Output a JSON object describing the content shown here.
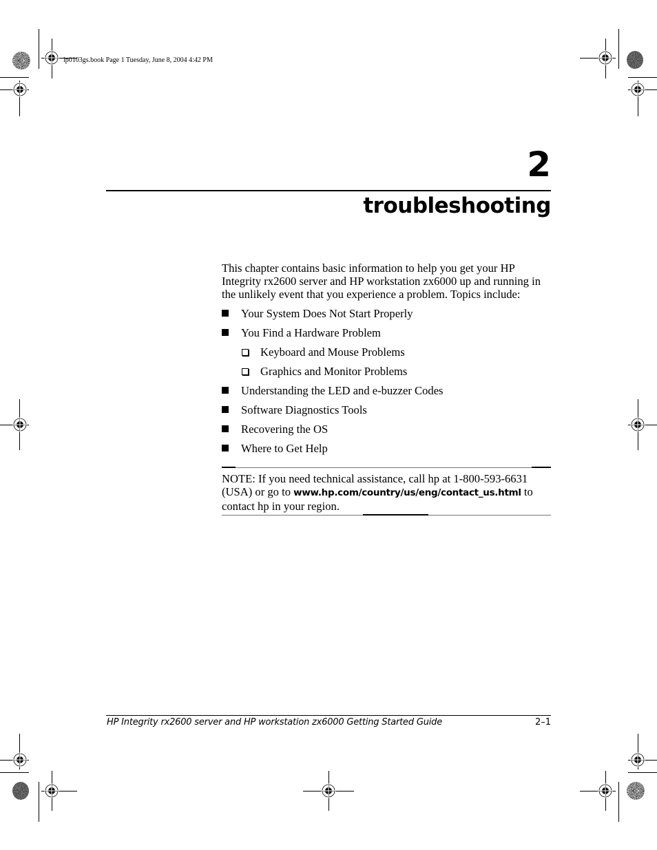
{
  "slug": {
    "text": "lp0103gs.book  Page 1  Tuesday, June 8, 2004  4:42 PM"
  },
  "chapter": {
    "number": "2",
    "title": "troubleshooting"
  },
  "intro": "This chapter contains basic information to help you get your HP Integrity rx2600 server and HP workstation zx6000 up and running in the unlikely event that you experience a problem. Topics include:",
  "topics": [
    {
      "label": "Your System Does Not Start Properly",
      "level": 1,
      "bullet": "filled-square"
    },
    {
      "label": "You Find a Hardware Problem",
      "level": 1,
      "bullet": "filled-square"
    },
    {
      "label": "Keyboard and Mouse Problems",
      "level": 2,
      "bullet": "hollow-square"
    },
    {
      "label": "Graphics and Monitor Problems",
      "level": 2,
      "bullet": "hollow-square"
    },
    {
      "label": "Understanding the LED and e-buzzer Codes",
      "level": 1,
      "bullet": "filled-square"
    },
    {
      "label": "Software Diagnostics Tools",
      "level": 1,
      "bullet": "filled-square"
    },
    {
      "label": "Recovering the OS",
      "level": 1,
      "bullet": "filled-square"
    },
    {
      "label": "Where to Get Help",
      "level": 1,
      "bullet": "filled-square"
    }
  ],
  "note": {
    "prefix": "NOTE: If you need technical assistance, call hp at 1-800-593-6631 (USA) or go to ",
    "url": "www.hp.com/country/us/eng/contact_us.html",
    "suffix": " to contact hp in your region."
  },
  "footer": {
    "title": "HP Integrity rx2600 server and HP workstation zx6000 Getting Started Guide",
    "page": "2–1"
  }
}
